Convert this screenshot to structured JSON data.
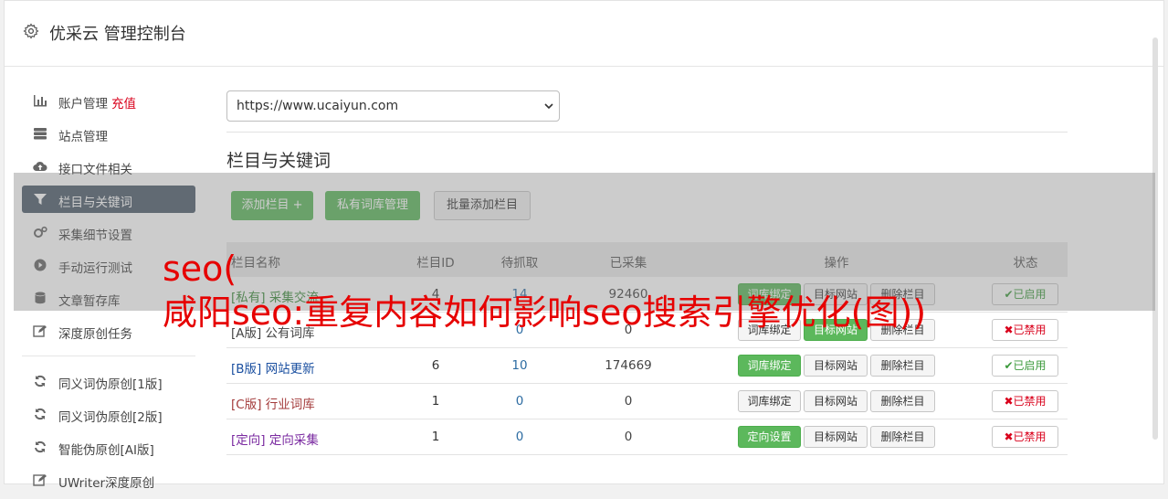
{
  "header": {
    "title": "优采云 管理控制台",
    "icon": "gear-icon"
  },
  "sidebar": {
    "items": [
      {
        "label": "账户管理",
        "extra": "充值",
        "icon": "bar-chart-icon"
      },
      {
        "label": "站点管理",
        "icon": "server-icon"
      },
      {
        "label": "接口文件相关",
        "icon": "cloud-upload-icon"
      },
      {
        "label": "栏目与关键词",
        "icon": "filter-icon",
        "active": true
      },
      {
        "label": "采集细节设置",
        "icon": "cogs-icon"
      },
      {
        "label": "手动运行测试",
        "icon": "play-circle-icon"
      },
      {
        "label": "文章暂存库",
        "icon": "database-icon"
      },
      {
        "label": "深度原创任务",
        "icon": "edit-icon"
      }
    ],
    "items2": [
      {
        "label": "同义词伪原创[1版]",
        "icon": "refresh-icon"
      },
      {
        "label": "同义词伪原创[2版]",
        "icon": "refresh-icon"
      },
      {
        "label": "智能伪原创[AI版]",
        "icon": "refresh-icon"
      },
      {
        "label": "UWriter深度原创",
        "icon": "edit-icon"
      }
    ]
  },
  "main": {
    "site_select": {
      "value": "https://www.ucaiyun.com"
    },
    "section_title": "栏目与关键词",
    "buttons": {
      "add_column": "添加栏目 +",
      "private_lib": "私有词库管理",
      "batch_add": "批量添加栏目"
    },
    "table": {
      "headers": {
        "name": "栏目名称",
        "id": "栏目ID",
        "todo": "待抓取",
        "done": "已采集",
        "op": "操作",
        "status": "状态"
      },
      "rows": [
        {
          "name": "[私有] 采集交流",
          "id": "4",
          "todo": "14",
          "done": "92460",
          "op1": "词库绑定",
          "op2": "目标网站",
          "op3": "删除栏目",
          "status": "✔已启用",
          "name_color": "#3a8a3a",
          "op1_style": "green",
          "op2_style": "gray",
          "status_on": true
        },
        {
          "name": "[A版] 公有词库",
          "id": "",
          "todo": "0",
          "done": "0",
          "op1": "词库绑定",
          "op2": "目标网站",
          "op3": "删除栏目",
          "status": "✖已禁用",
          "name_color": "#444444",
          "op1_style": "gray",
          "op2_style": "green",
          "status_on": false
        },
        {
          "name": "[B版] 网站更新",
          "id": "6",
          "todo": "10",
          "done": "174669",
          "op1": "词库绑定",
          "op2": "目标网站",
          "op3": "删除栏目",
          "status": "✔已启用",
          "name_color": "#1a4fa0",
          "op1_style": "green",
          "op2_style": "gray",
          "status_on": true
        },
        {
          "name": "[C版] 行业词库",
          "id": "1",
          "todo": "0",
          "done": "0",
          "op1": "词库绑定",
          "op2": "目标网站",
          "op3": "删除栏目",
          "status": "✖已禁用",
          "name_color": "#a33a3a",
          "op1_style": "gray",
          "op2_style": "gray",
          "status_on": false
        },
        {
          "name": "[定向] 定向采集",
          "id": "1",
          "todo": "0",
          "done": "0",
          "op1": "定向设置",
          "op2": "目标网站",
          "op3": "删除栏目",
          "status": "✖已禁用",
          "name_color": "#7a2aa0",
          "op1_style": "green",
          "op2_style": "gray",
          "status_on": false
        }
      ]
    }
  },
  "overlay": {
    "line1": "seo(",
    "line2": "咸阳seo:重复内容如何影响seo搜索引擎优化(图))"
  }
}
